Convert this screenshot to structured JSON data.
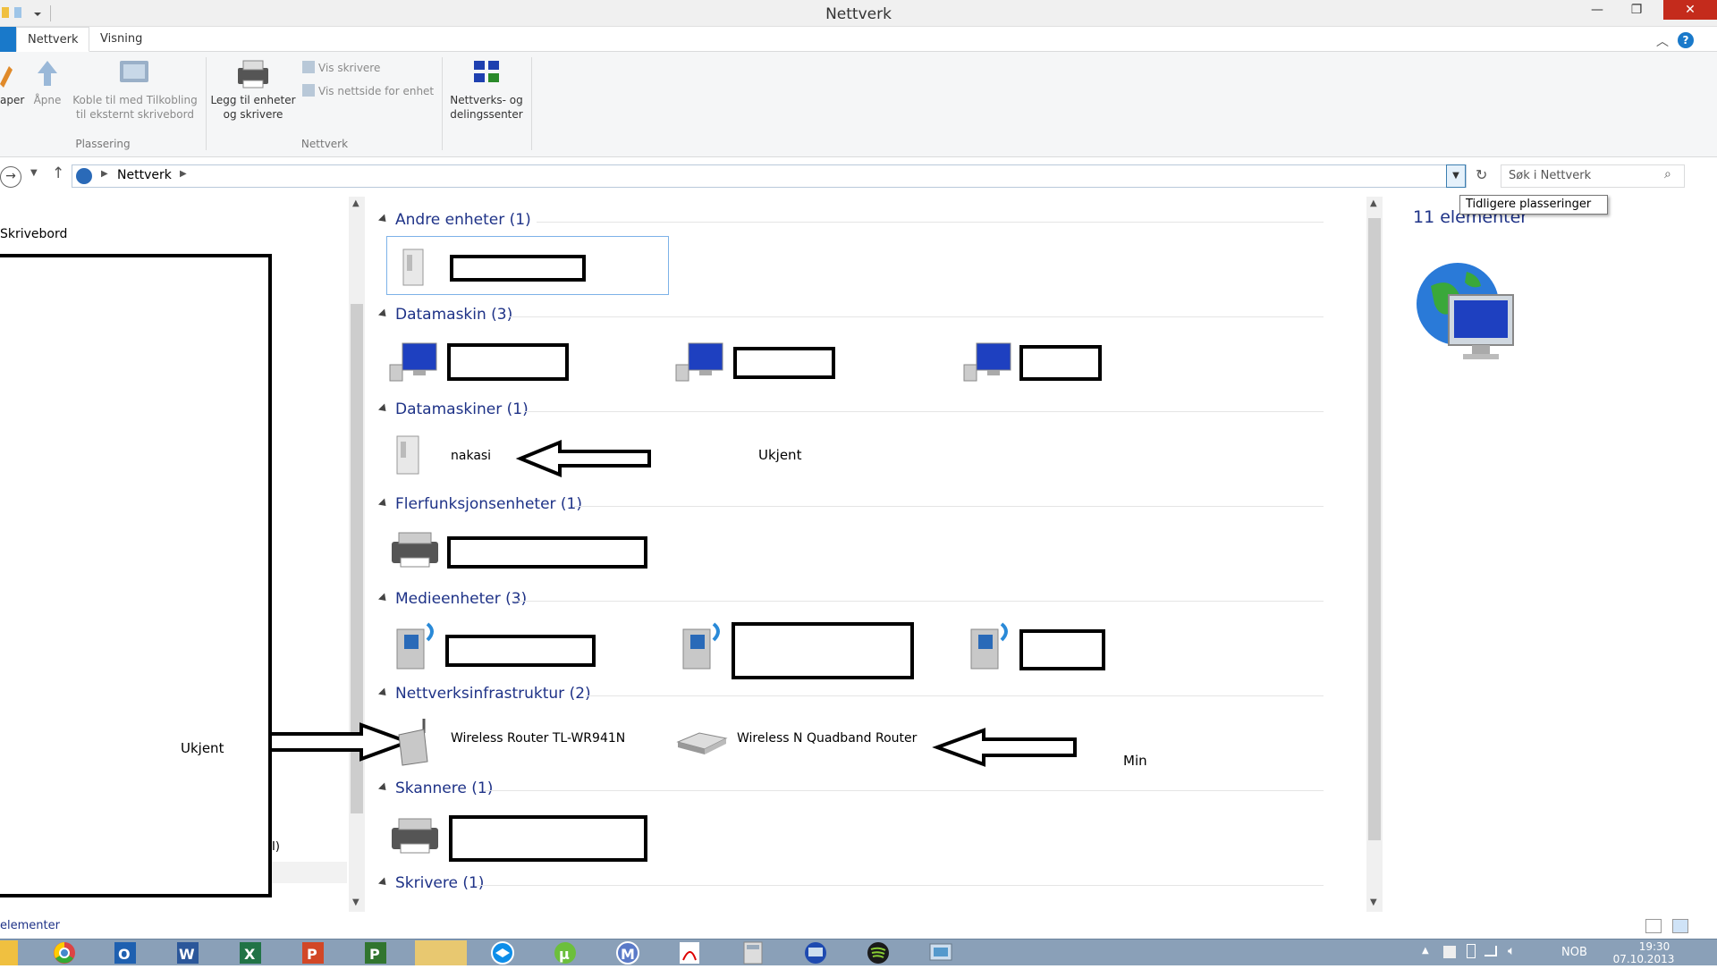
{
  "window": {
    "title": "Nettverk"
  },
  "ribbon": {
    "tabs": [
      {
        "label": "Nettverk"
      },
      {
        "label": "Visning"
      }
    ],
    "buttons": {
      "properties": "aper",
      "open": "Åpne",
      "connect": "Koble til med Tilkobling til eksternt skrivebord",
      "add_devices": "Legg til enheter og skrivere",
      "show_printers": "Vis skrivere",
      "show_webpage": "Vis nettside for enhet",
      "network_center": "Nettverks- og delingssenter"
    },
    "groups": {
      "location": "Plassering",
      "network": "Nettverk"
    }
  },
  "address": {
    "path": "Nettverk",
    "search_placeholder": "Søk i Nettverk",
    "tooltip": "Tidligere plasseringer"
  },
  "navpane": {
    "desktop": "Skrivebord",
    "annotation": "Ukjent",
    "partial_text": "I)",
    "partial_status": "elementer"
  },
  "groups": [
    {
      "label": "Andre enheter (1)"
    },
    {
      "label": "Datamaskin (3)"
    },
    {
      "label": "Datamaskiner (1)",
      "item": "nakasi",
      "note": "Ukjent"
    },
    {
      "label": "Flerfunksjonsenheter (1)"
    },
    {
      "label": "Medieenheter (3)"
    },
    {
      "label": "Nettverksinfrastruktur (2)",
      "items": [
        "Wireless Router TL-WR941N",
        "Wireless N Quadband Router"
      ],
      "note": "Min"
    },
    {
      "label": "Skannere (1)"
    },
    {
      "label": "Skrivere (1)"
    }
  ],
  "details": {
    "count": "11 elementer"
  },
  "taskbar": {
    "lang": "NOB",
    "time": "19:30",
    "date": "07.10.2013"
  },
  "colors": {
    "accent": "#1979ca",
    "group_header": "#1e3287",
    "close": "#c42b1c"
  }
}
